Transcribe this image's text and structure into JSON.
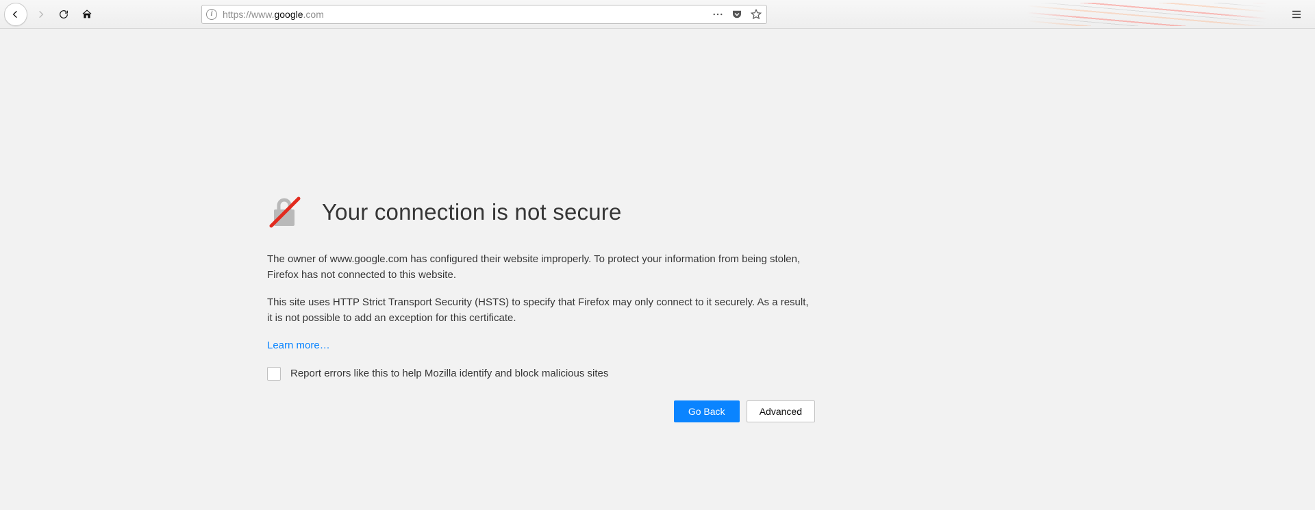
{
  "toolbar": {
    "url_dim_prefix": "https://www.",
    "url_domain": "google",
    "url_dim_suffix": ".com"
  },
  "error": {
    "title": "Your connection is not secure",
    "p1": "The owner of www.google.com has configured their website improperly. To protect your information from being stolen, Firefox has not connected to this website.",
    "p2": "This site uses HTTP Strict Transport Security (HSTS) to specify that Firefox may only connect to it securely. As a result, it is not possible to add an exception for this certificate.",
    "learn": "Learn more…",
    "report": "Report errors like this to help Mozilla identify and block malicious sites",
    "go_back": "Go Back",
    "advanced": "Advanced"
  }
}
